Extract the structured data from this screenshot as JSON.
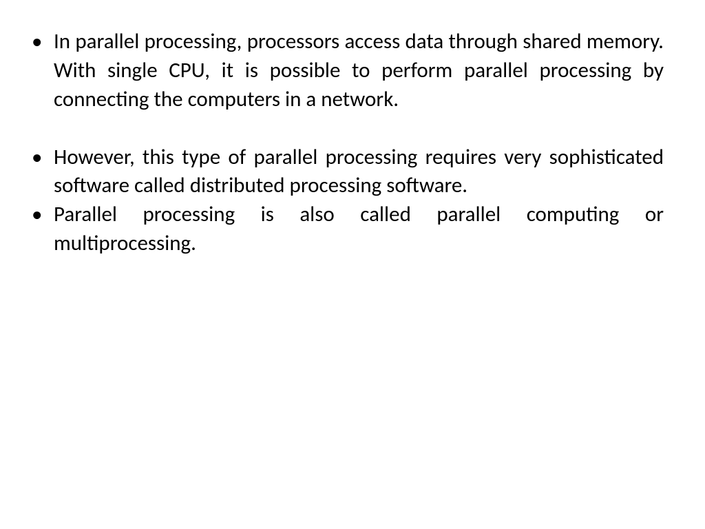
{
  "slide": {
    "bullets": [
      "In parallel processing, processors access data through shared memory. With single CPU, it is possible to perform parallel processing by connecting the computers in a network.",
      "However, this type of parallel processing requires very sophisticated software called distributed processing software.",
      "Parallel processing is also called parallel computing or multiprocessing."
    ]
  }
}
